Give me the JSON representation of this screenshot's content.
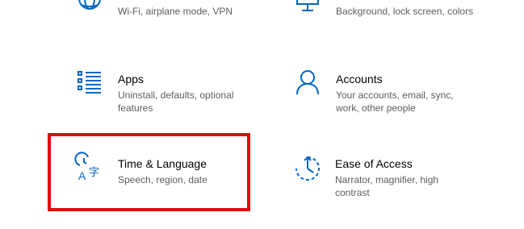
{
  "accent_color": "#0067c0",
  "highlight_color": "#e4080a",
  "tiles": [
    {
      "id": "network",
      "icon": "globe-icon",
      "title": "",
      "description": "Wi-Fi, airplane mode, VPN"
    },
    {
      "id": "personalization",
      "icon": "monitor-pen-icon",
      "title": "",
      "description": "Background, lock screen, colors"
    },
    {
      "id": "apps",
      "icon": "apps-list-icon",
      "title": "Apps",
      "description": "Uninstall, defaults, optional features"
    },
    {
      "id": "accounts",
      "icon": "person-icon",
      "title": "Accounts",
      "description": "Your accounts, email, sync, work, other people"
    },
    {
      "id": "time-language",
      "icon": "time-language-icon",
      "title": "Time & Language",
      "description": "Speech, region, date"
    },
    {
      "id": "ease-of-access",
      "icon": "ease-of-access-icon",
      "title": "Ease of Access",
      "description": "Narrator, magnifier, high contrast"
    }
  ]
}
